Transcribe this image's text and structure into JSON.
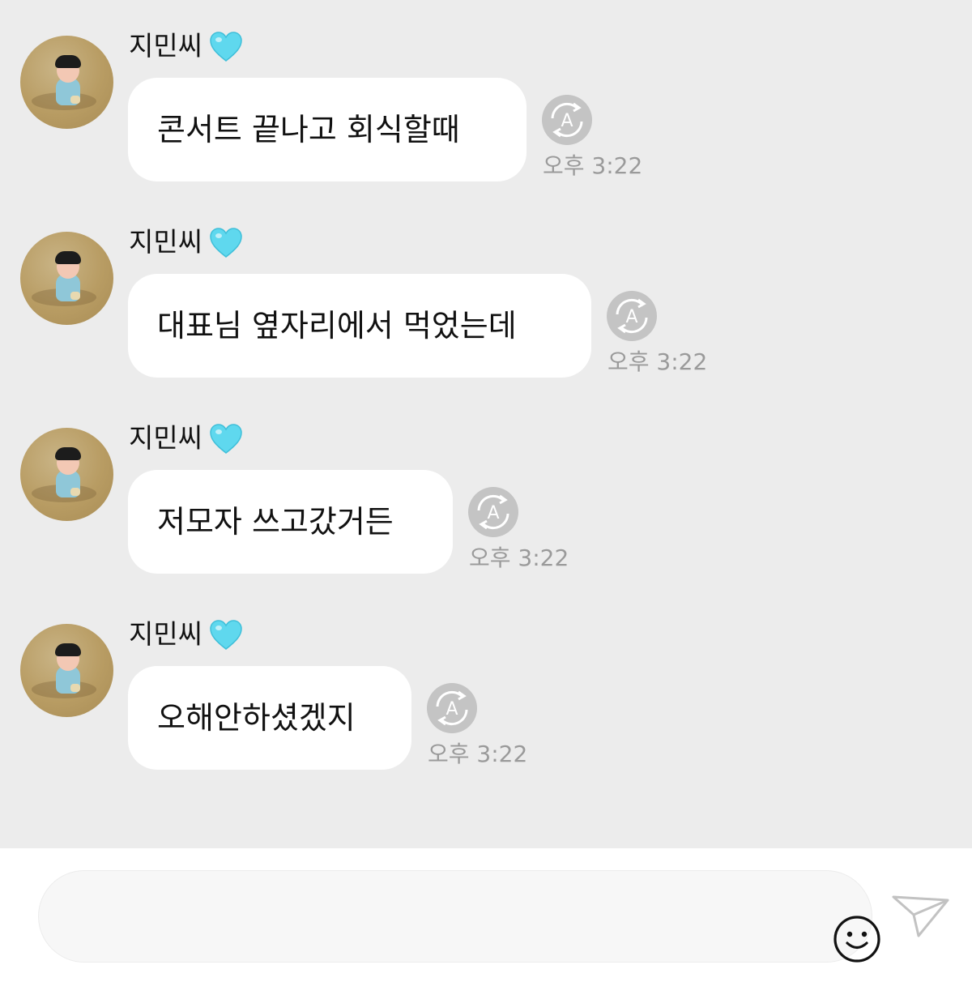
{
  "chat": {
    "messages": [
      {
        "sender": "지민씨",
        "text": "콘서트 끝나고 회식할때",
        "time": "오후 3:22"
      },
      {
        "sender": "지민씨",
        "text": "대표님 옆자리에서 먹었는데",
        "time": "오후 3:22"
      },
      {
        "sender": "지민씨",
        "text": "저모자 쓰고갔거든",
        "time": "오후 3:22"
      },
      {
        "sender": "지민씨",
        "text": "오해안하셨겠지",
        "time": "오후 3:22"
      }
    ]
  },
  "composer": {
    "value": "",
    "emoji_icon": "smiley-icon",
    "send_icon": "paper-plane-icon"
  },
  "icons": {
    "heart": "light-blue-heart-icon",
    "translate": "translate-a-icon"
  },
  "colors": {
    "chat_background": "#ececec",
    "bubble": "#ffffff",
    "heart": "#5fd8ee",
    "timestamp": "#9a9a9a",
    "icon_gray": "#c4c4c4"
  }
}
